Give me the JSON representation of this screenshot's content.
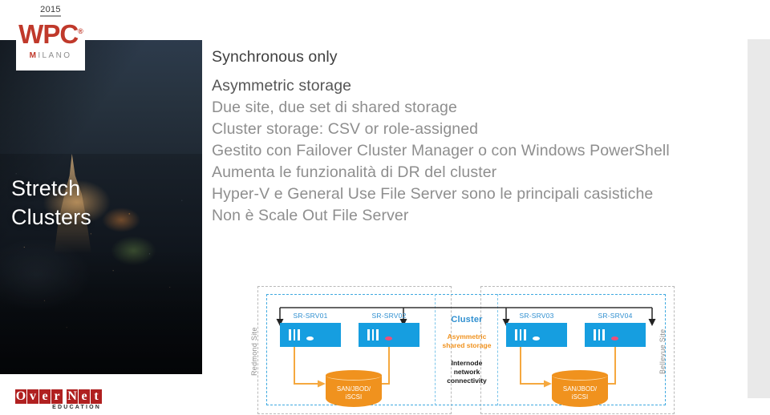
{
  "slide": {
    "brand": {
      "year": "2015",
      "wpc_main": "WPC",
      "wpc_tm": "®",
      "milano_m": "M",
      "milano_rest": "ILANO",
      "hero_line1": "Stretch",
      "hero_line2": "Clusters",
      "overnet_letters": [
        "O",
        "v",
        "e",
        "r",
        "N",
        "e",
        "t"
      ],
      "overnet_sub": "EDUCATION",
      "accent_red": "#c0392b",
      "accent_blue": "#169ee0",
      "accent_orange": "#f0921e"
    },
    "bullets": [
      {
        "text": "Synchronous only",
        "tone": "dark"
      },
      {
        "text": "Asymmetric storage",
        "tone": "mid"
      },
      {
        "text": "Due site, due set di shared storage",
        "tone": "grey"
      },
      {
        "text": "Cluster storage: CSV or role-assigned",
        "tone": "grey"
      },
      {
        "text": "Gestito con Failover Cluster Manager o con Windows PowerShell",
        "tone": "grey"
      },
      {
        "text": "Aumenta le funzionalità di DR del cluster",
        "tone": "grey"
      },
      {
        "text": "Hyper-V e General Use File Server sono le principali casistiche",
        "tone": "grey"
      },
      {
        "text": "Non è Scale Out File Server",
        "tone": "grey"
      }
    ],
    "diagram": {
      "site_left_label": "Redmond Site",
      "site_right_label": "Bellevue Site",
      "servers": [
        {
          "name": "SR-SRV01",
          "led": "white"
        },
        {
          "name": "SR-SRV02",
          "led": "pink"
        },
        {
          "name": "SR-SRV03",
          "led": "white"
        },
        {
          "name": "SR-SRV04",
          "led": "pink"
        }
      ],
      "storage_left_line1": "SAN/JBOD/",
      "storage_left_line2": "iSCSI",
      "storage_right_line1": "SAN/JBOD/",
      "storage_right_line2": "iSCSI",
      "center_cluster": "Cluster",
      "center_asym_line1": "Asymmetric",
      "center_asym_line2": "shared storage",
      "center_inter_line1": "Internode",
      "center_inter_line2": "network",
      "center_inter_line3": "connectivity"
    }
  }
}
